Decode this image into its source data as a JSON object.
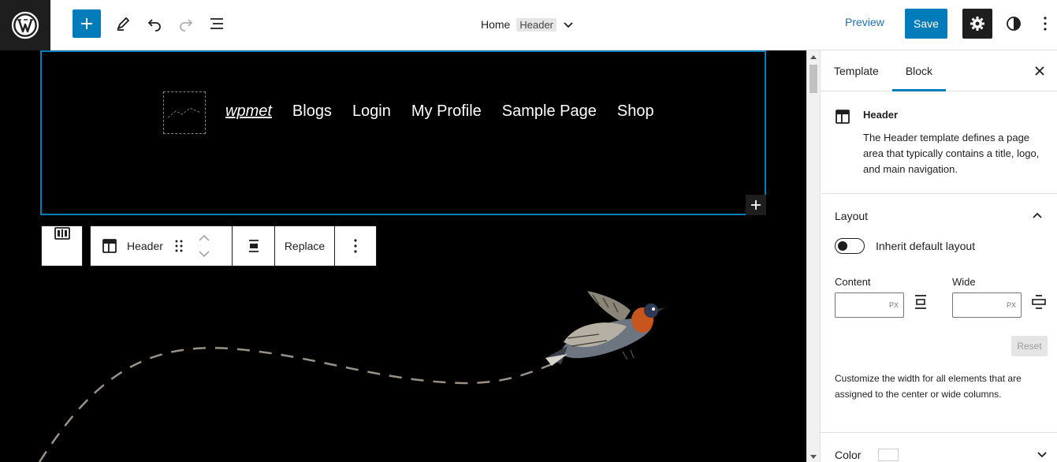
{
  "topbar": {
    "breadcrumb_home": "Home",
    "breadcrumb_current": "Header",
    "preview_label": "Preview",
    "save_label": "Save"
  },
  "canvas": {
    "nav_items": [
      "wpmet",
      "Blogs",
      "Login",
      "My Profile",
      "Sample Page",
      "Shop"
    ],
    "toolbar": {
      "block_label": "Header",
      "replace_label": "Replace"
    }
  },
  "sidebar": {
    "tabs": [
      "Template",
      "Block"
    ],
    "active_tab": "Block",
    "block": {
      "title": "Header",
      "description": "The Header template defines a page area that typically contains a title, logo, and main navigation."
    },
    "layout": {
      "heading": "Layout",
      "toggle_label": "Inherit default layout",
      "content_label": "Content",
      "wide_label": "Wide",
      "unit": "PX",
      "reset_label": "Reset",
      "help": "Customize the width for all elements that are assigned to the center or wide columns."
    },
    "color": {
      "heading": "Color"
    }
  },
  "colors": {
    "accent": "#007cba",
    "dark": "#1e1e1e",
    "canvas_bg": "#000000"
  }
}
